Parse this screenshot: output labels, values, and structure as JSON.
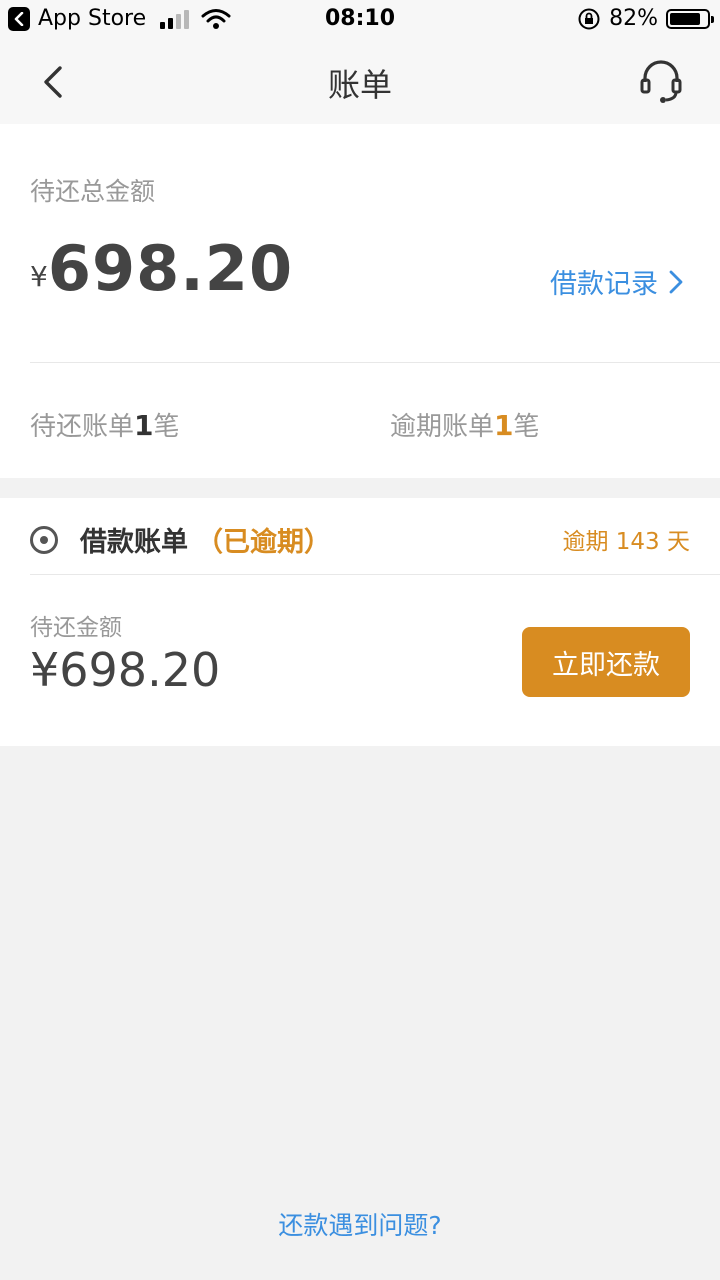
{
  "status_bar": {
    "back_app": "App Store",
    "time": "08:10",
    "battery": "82%",
    "battery_level": 0.82
  },
  "nav": {
    "title": "账单"
  },
  "summary": {
    "label": "待还总金额",
    "currency": "¥",
    "amount": "698.20",
    "loan_record": "借款记录",
    "pending_prefix": "待还账单",
    "pending_count": "1",
    "pending_suffix": "笔",
    "overdue_prefix": "逾期账单",
    "overdue_count": "1",
    "overdue_suffix": "笔"
  },
  "bill": {
    "title": "借款账单",
    "status": "（已逾期）",
    "overdue_days": "逾期 143 天",
    "due_label": "待还金额",
    "due_amount": "¥698.20",
    "pay_button": "立即还款"
  },
  "footer": {
    "help": "还款遇到问题?"
  },
  "colors": {
    "accent_orange": "#d88c21",
    "link_blue": "#3b8fe0",
    "background": "#f2f2f2"
  }
}
